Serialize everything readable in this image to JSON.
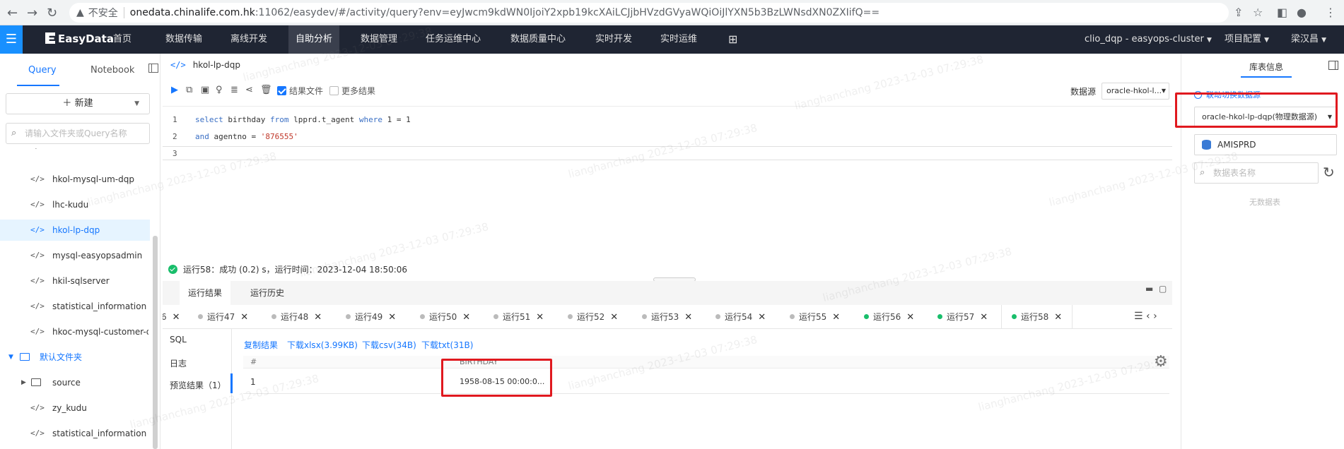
{
  "browser": {
    "insecure_label": "不安全",
    "host": "onedata.chinalife.com.hk",
    "path": ":11062/easydev/#/activity/query?env=eyJwcm9kdWN0IjoiY2xpb19kcXAiLCJjbHVzdGVyaWQiOiJlYXN5b3BzLWNsdXN0ZXIifQ=="
  },
  "app": {
    "logo": "EasyData",
    "nav": [
      "首页",
      "数据传输",
      "离线开发",
      "自助分析",
      "数据管理",
      "任务运维中心",
      "数据质量中心",
      "实时开发",
      "实时运维"
    ],
    "cluster": "clio_dqp - easyops-cluster",
    "project": "项目配置",
    "user": "梁汉昌"
  },
  "left": {
    "tab_query": "Query",
    "tab_notebook": "Notebook",
    "new_label": "新建",
    "search_placeholder": "请输入文件夹或Query名称",
    "items": [
      "hkol-mysql-um-dqp",
      "lhc-kudu",
      "hkol-lp-dqp",
      "mysql-easyopsadmin",
      "hkil-sqlserver",
      "statistical_information",
      "hkoc-mysql-customer-d..."
    ],
    "folder": "默认文件夹",
    "subfolder": "source",
    "sub_items": [
      "zy_kudu",
      "statistical_information"
    ]
  },
  "editor": {
    "tab_title": "hkol-lp-dqp",
    "result_file_label": "结果文件",
    "more_results_label": "更多结果",
    "datasource_label": "数据源",
    "datasource_value": "oracle-hkol-l...",
    "line_numbers": [
      "1",
      "2",
      "3"
    ],
    "line1": {
      "k1": "select",
      "c1": " birthday ",
      "k2": "from",
      "c2": " lpprd.t_agent ",
      "k3": "where",
      "c3": " 1 = 1"
    },
    "line2": {
      "k1": "and",
      "c1": " agentno = ",
      "s1": "'876555'"
    }
  },
  "status": {
    "text": "运行58：成功 (0.2) s，运行时间：2023-12-04 18:50:06"
  },
  "results": {
    "tabs": [
      "运行结果",
      "运行历史"
    ],
    "run_tabs": [
      {
        "label": "运行47"
      },
      {
        "label": "运行48"
      },
      {
        "label": "运行49"
      },
      {
        "label": "运行50"
      },
      {
        "label": "运行51"
      },
      {
        "label": "运行52"
      },
      {
        "label": "运行53"
      },
      {
        "label": "运行54"
      },
      {
        "label": "运行55"
      },
      {
        "label": "运行56"
      },
      {
        "label": "运行57"
      },
      {
        "label": "运行58"
      }
    ],
    "side_menu": [
      "SQL",
      "日志",
      "预览结果（1）"
    ],
    "links": [
      "复制结果",
      "下载xlsx(3.99KB)",
      "下载csv(34B)",
      "下载txt(31B)"
    ],
    "grid": {
      "col_index": "#",
      "col_birthday": "BIRTHDAY",
      "row_index": "1",
      "row_birthday": "1958-08-15 00:00:0..."
    }
  },
  "right": {
    "tab": "库表信息",
    "link_datasource": "联动切换数据源",
    "datasource": "oracle-hkol-lp-dqp(物理数据源)",
    "database": "AMISPRD",
    "search_placeholder": "数据表名称",
    "empty": "无数据表"
  },
  "watermark": "lianghanchang 2023-12-03 07:29:38",
  "colors": {
    "accent": "#1677ff",
    "header_bg": "#1f2533",
    "highlight": "#e0191f",
    "success": "#19be6b"
  }
}
